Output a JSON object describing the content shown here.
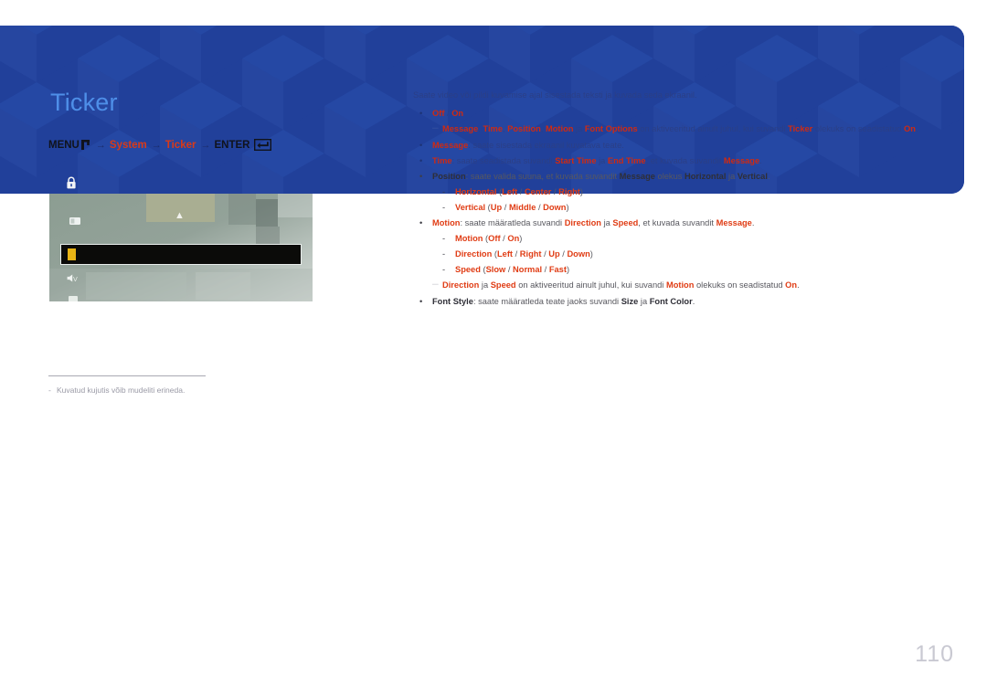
{
  "page": {
    "title": "Ticker",
    "number": "110"
  },
  "menu_path": {
    "menu_label": "MENU",
    "menu_icon": "menu-key-icon",
    "arrow": "→",
    "step1": "System",
    "step2": "Ticker",
    "enter_label": "ENTER",
    "enter_icon": "enter-key-icon"
  },
  "osd": {
    "screenshot_name": "ticker-osd-screenshot",
    "lock_icon": "lock-icon",
    "chevron_icon": "chevron-up-icon",
    "highlight_icon": "ticker-menu-item-icon",
    "row_icons": [
      "picture-icon",
      "sound-icon",
      "network-icon",
      "system-icon"
    ]
  },
  "footnote": {
    "dash": "-",
    "text": "Kuvatud kujutis võib mudeliti erineda."
  },
  "content": {
    "intro": "Saate video või pildi kuvamise ajal sisestada teksti ja kuvada seda ekraanil.",
    "bullet_marker": "•",
    "dash_marker": "-",
    "note_marker": "─",
    "items": [
      {
        "id": "off-on",
        "level": 1,
        "theme": "blue",
        "kind": "bullet",
        "parts": [
          {
            "t": "Off",
            "s": "kw"
          },
          {
            "t": " / ",
            "s": "pl"
          },
          {
            "t": "On",
            "s": "kw"
          }
        ]
      },
      {
        "id": "note-ticker-on",
        "level": 1,
        "theme": "blue",
        "kind": "note",
        "parts": [
          {
            "t": "Message",
            "s": "kw"
          },
          {
            "t": ", ",
            "s": "pl"
          },
          {
            "t": "Time",
            "s": "kw"
          },
          {
            "t": ", ",
            "s": "pl"
          },
          {
            "t": "Position",
            "s": "kw"
          },
          {
            "t": ", ",
            "s": "pl"
          },
          {
            "t": "Motion",
            "s": "kw"
          },
          {
            "t": " ja ",
            "s": "pl"
          },
          {
            "t": "Font Options",
            "s": "kw"
          },
          {
            "t": " on aktiveeritud ainult juhul, kui suvandi ",
            "s": "pl"
          },
          {
            "t": "Ticker",
            "s": "kw"
          },
          {
            "t": " olekuks on seadistatud ",
            "s": "pl"
          },
          {
            "t": "On",
            "s": "kw"
          },
          {
            "t": ".",
            "s": "pl"
          }
        ]
      },
      {
        "id": "message",
        "level": 1,
        "theme": "blue",
        "kind": "bullet",
        "parts": [
          {
            "t": "Message",
            "s": "kw"
          },
          {
            "t": ": saate sisestada ekraanil kuvatava teate.",
            "s": "pl"
          }
        ]
      },
      {
        "id": "time",
        "level": 1,
        "theme": "blue",
        "kind": "bullet",
        "parts": [
          {
            "t": "Time",
            "s": "kw"
          },
          {
            "t": ": saate seadistada suvandi ",
            "s": "pl"
          },
          {
            "t": "Start Time",
            "s": "kw"
          },
          {
            "t": " ja ",
            "s": "pl"
          },
          {
            "t": "End Time",
            "s": "kw"
          },
          {
            "t": ", et kuvada suvandit ",
            "s": "pl"
          },
          {
            "t": "Message",
            "s": "kw"
          },
          {
            "t": ".",
            "s": "pl"
          }
        ]
      },
      {
        "id": "position",
        "level": 1,
        "theme": "white",
        "kind": "bullet",
        "parts": [
          {
            "t": "Position",
            "s": "kwb"
          },
          {
            "t": ": saate valida suuna, et kuvada suvandit ",
            "s": "pl"
          },
          {
            "t": "Message",
            "s": "kwb"
          },
          {
            "t": " olekus ",
            "s": "pl"
          },
          {
            "t": "Horizontal",
            "s": "kwb"
          },
          {
            "t": " ja ",
            "s": "pl"
          },
          {
            "t": "Vertical",
            "s": "kwb"
          },
          {
            "t": ".",
            "s": "pl"
          }
        ]
      },
      {
        "id": "horizontal",
        "level": 2,
        "theme": "white",
        "kind": "dash",
        "parts": [
          {
            "t": "Horizontal",
            "s": "kw"
          },
          {
            "t": " (",
            "s": "pl"
          },
          {
            "t": "Left",
            "s": "kw"
          },
          {
            "t": " / ",
            "s": "pl"
          },
          {
            "t": "Center",
            "s": "kw"
          },
          {
            "t": " / ",
            "s": "pl"
          },
          {
            "t": "Right",
            "s": "kw"
          },
          {
            "t": ")",
            "s": "pl"
          }
        ]
      },
      {
        "id": "vertical",
        "level": 2,
        "theme": "white",
        "kind": "dash",
        "parts": [
          {
            "t": "Vertical",
            "s": "kw"
          },
          {
            "t": " (",
            "s": "pl"
          },
          {
            "t": "Up",
            "s": "kw"
          },
          {
            "t": " / ",
            "s": "pl"
          },
          {
            "t": "Middle",
            "s": "kw"
          },
          {
            "t": " / ",
            "s": "pl"
          },
          {
            "t": "Down",
            "s": "kw"
          },
          {
            "t": ")",
            "s": "pl"
          }
        ]
      },
      {
        "id": "motion",
        "level": 1,
        "theme": "white",
        "kind": "bullet",
        "parts": [
          {
            "t": "Motion",
            "s": "kw"
          },
          {
            "t": ": saate määratleda suvandi ",
            "s": "pl"
          },
          {
            "t": "Direction",
            "s": "kw"
          },
          {
            "t": " ja ",
            "s": "pl"
          },
          {
            "t": "Speed",
            "s": "kw"
          },
          {
            "t": ", et kuvada suvandit ",
            "s": "pl"
          },
          {
            "t": "Message",
            "s": "kw"
          },
          {
            "t": ".",
            "s": "pl"
          }
        ]
      },
      {
        "id": "motion-sub",
        "level": 2,
        "theme": "white",
        "kind": "dash",
        "parts": [
          {
            "t": "Motion",
            "s": "kw"
          },
          {
            "t": " (",
            "s": "pl"
          },
          {
            "t": "Off",
            "s": "kw"
          },
          {
            "t": " / ",
            "s": "pl"
          },
          {
            "t": "On",
            "s": "kw"
          },
          {
            "t": ")",
            "s": "pl"
          }
        ]
      },
      {
        "id": "direction",
        "level": 2,
        "theme": "white",
        "kind": "dash",
        "parts": [
          {
            "t": "Direction",
            "s": "kw"
          },
          {
            "t": " (",
            "s": "pl"
          },
          {
            "t": "Left",
            "s": "kw"
          },
          {
            "t": " / ",
            "s": "pl"
          },
          {
            "t": "Right",
            "s": "kw"
          },
          {
            "t": " / ",
            "s": "pl"
          },
          {
            "t": "Up",
            "s": "kw"
          },
          {
            "t": " / ",
            "s": "pl"
          },
          {
            "t": "Down",
            "s": "kw"
          },
          {
            "t": ")",
            "s": "pl"
          }
        ]
      },
      {
        "id": "speed",
        "level": 2,
        "theme": "white",
        "kind": "dash",
        "parts": [
          {
            "t": "Speed",
            "s": "kw"
          },
          {
            "t": " (",
            "s": "pl"
          },
          {
            "t": "Slow",
            "s": "kw"
          },
          {
            "t": " / ",
            "s": "pl"
          },
          {
            "t": "Normal",
            "s": "kw"
          },
          {
            "t": " / ",
            "s": "pl"
          },
          {
            "t": "Fast",
            "s": "kw"
          },
          {
            "t": ")",
            "s": "pl"
          }
        ]
      },
      {
        "id": "note-motion-on",
        "level": 1,
        "theme": "white",
        "kind": "note",
        "parts": [
          {
            "t": "Direction",
            "s": "kw"
          },
          {
            "t": " ja ",
            "s": "pl"
          },
          {
            "t": "Speed",
            "s": "kw"
          },
          {
            "t": " on aktiveeritud ainult juhul, kui suvandi ",
            "s": "pl"
          },
          {
            "t": "Motion",
            "s": "kw"
          },
          {
            "t": " olekuks on seadistatud ",
            "s": "pl"
          },
          {
            "t": "On",
            "s": "kw"
          },
          {
            "t": ".",
            "s": "pl"
          }
        ]
      },
      {
        "id": "font-style",
        "level": 1,
        "theme": "white",
        "kind": "bullet",
        "parts": [
          {
            "t": "Font Style",
            "s": "kwb"
          },
          {
            "t": ": saate määratleda teate jaoks suvandi ",
            "s": "pl"
          },
          {
            "t": "Size",
            "s": "kwb"
          },
          {
            "t": " ja ",
            "s": "pl"
          },
          {
            "t": "Font Color",
            "s": "kwb"
          },
          {
            "t": ".",
            "s": "pl"
          }
        ]
      }
    ]
  },
  "colors": {
    "banner_blue": "#21409a",
    "title_blue": "#4e8fe8",
    "accent_red": "#e03c14",
    "body_gray": "#58585f",
    "note_gray": "#9b9ba6",
    "page_number_gray": "#c9c9d2"
  }
}
